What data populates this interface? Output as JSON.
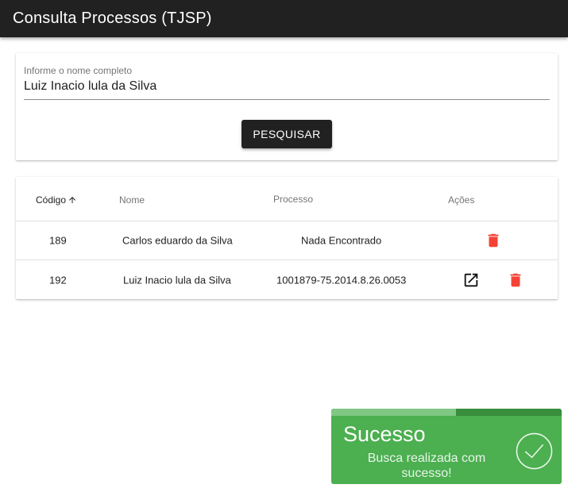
{
  "app": {
    "title": "Consulta Processos (TJSP)"
  },
  "search": {
    "label": "Informe o nome completo",
    "value": "Luiz Inacio lula da Silva",
    "button_label": "PESQUISAR"
  },
  "table": {
    "headers": {
      "codigo": "Código",
      "nome": "Nome",
      "processo": "Processo",
      "acoes": "Ações"
    },
    "sort": {
      "column": "codigo",
      "direction": "ascending",
      "icon": "arrow-up-icon"
    },
    "rows": [
      {
        "codigo": "189",
        "nome": "Carlos eduardo da Silva",
        "processo": "Nada Encontrado",
        "actions": [
          "delete-icon"
        ]
      },
      {
        "codigo": "192",
        "nome": "Luiz Inacio lula da Silva",
        "processo": "1001879-75.2014.8.26.0053",
        "actions": [
          "open-in-new-icon",
          "delete-icon"
        ]
      }
    ]
  },
  "toast": {
    "title": "Sucesso",
    "message": "Busca realizada com sucesso!",
    "progress": 0.54,
    "icon": "check-circle-icon",
    "color": "#4caf50"
  },
  "colors": {
    "appbar": "#212121",
    "delete": "#f44336",
    "toast": "#4caf50"
  }
}
